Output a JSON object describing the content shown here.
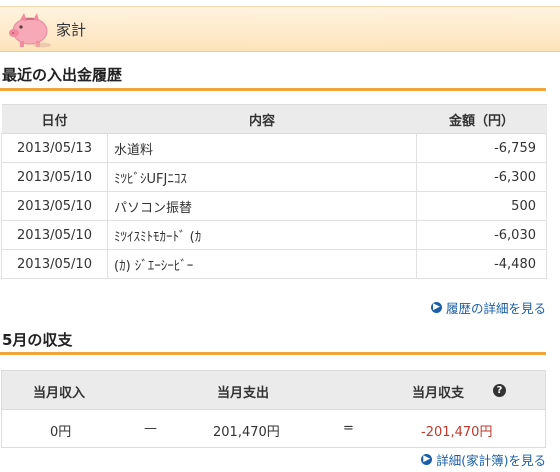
{
  "header": {
    "title": "家計",
    "icon": "piggy-bank-icon"
  },
  "history": {
    "title": "最近の入出金履歴",
    "columns": [
      "日付",
      "内容",
      "金額（円）"
    ],
    "rows": [
      {
        "date": "2013/05/13",
        "desc": "水道料",
        "amount": "-6,759"
      },
      {
        "date": "2013/05/10",
        "desc": "ﾐﾂﾋﾞｼUFJﾆｺｽ",
        "amount": "-6,300"
      },
      {
        "date": "2013/05/10",
        "desc": "パソコン振替",
        "amount": "500"
      },
      {
        "date": "2013/05/10",
        "desc": "ﾐﾂｲｽﾐﾄﾓｶｰﾄﾞ (ｶ",
        "amount": "-6,030"
      },
      {
        "date": "2013/05/10",
        "desc": "(ｶ) ｼﾞｴｰｼｰﾋﾞｰ",
        "amount": "-4,480"
      }
    ],
    "more_link": "履歴の詳細を見る"
  },
  "summary": {
    "title": "5月の収支",
    "income_label": "当月収入",
    "expense_label": "当月支出",
    "balance_label": "当月収支",
    "income_value": "0円",
    "minus_sign": "—",
    "expense_value": "201,470円",
    "equals_sign": "=",
    "balance_value": "-201,470円",
    "help_icon": "question-circle-icon",
    "more_link": "詳細(家計簿)を見る"
  },
  "colors": {
    "accent": "#f0a43a",
    "link": "#1a5fa8",
    "negative": "#c0392b",
    "header_bg": "#fde3bb"
  }
}
